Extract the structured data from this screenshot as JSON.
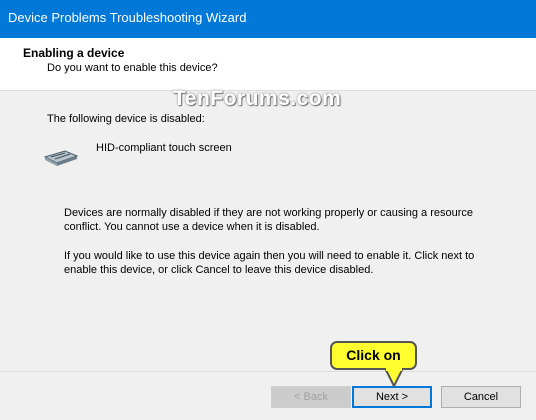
{
  "window": {
    "title": "Device Problems Troubleshooting Wizard"
  },
  "header": {
    "title": "Enabling a device",
    "subtitle": "Do you want to enable this device?"
  },
  "watermark": "TenForums.com",
  "content": {
    "disabled_label": "The following device is disabled:",
    "device_name": "HID-compliant touch screen",
    "device_icon": "hid-device-icon",
    "paragraph1": "Devices are normally disabled if they are not working properly or causing a resource conflict. You cannot use a device when it is disabled.",
    "paragraph2": "If you would like to use this device again then you will need to enable it. Click next to enable this device, or click Cancel to leave this device disabled."
  },
  "buttons": {
    "back": "< Back",
    "next": "Next >",
    "cancel": "Cancel"
  },
  "callout": {
    "text": "Click on",
    "color": "#ffff30"
  },
  "colors": {
    "titlebar": "#0078d7",
    "accent": "#0078d7"
  }
}
